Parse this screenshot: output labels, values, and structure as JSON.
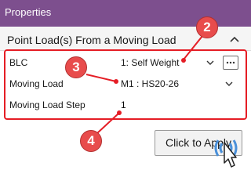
{
  "panel": {
    "title": "Properties"
  },
  "section": {
    "title": "Point Load(s) From a Moving Load",
    "collapse_icon": "chevron-up-icon"
  },
  "fields": {
    "blc": {
      "label": "BLC",
      "value": "1: Self Weight"
    },
    "moving_load": {
      "label": "Moving Load",
      "value": "M1 : HS20-26"
    },
    "moving_load_step": {
      "label": "Moving Load Step",
      "value": "1"
    }
  },
  "callouts": [
    "2",
    "3",
    "4"
  ],
  "apply_button": {
    "label": "Click to Apply"
  },
  "colors": {
    "title_bar": "#7d4f8e",
    "highlight": "#e51d25",
    "badge": "#e84c4c",
    "click_indicator": "#4a90d9"
  },
  "icons": {
    "select": "chevron-down-icon",
    "more": "ellipsis-icon",
    "cursor": "pointer-cursor-icon"
  }
}
